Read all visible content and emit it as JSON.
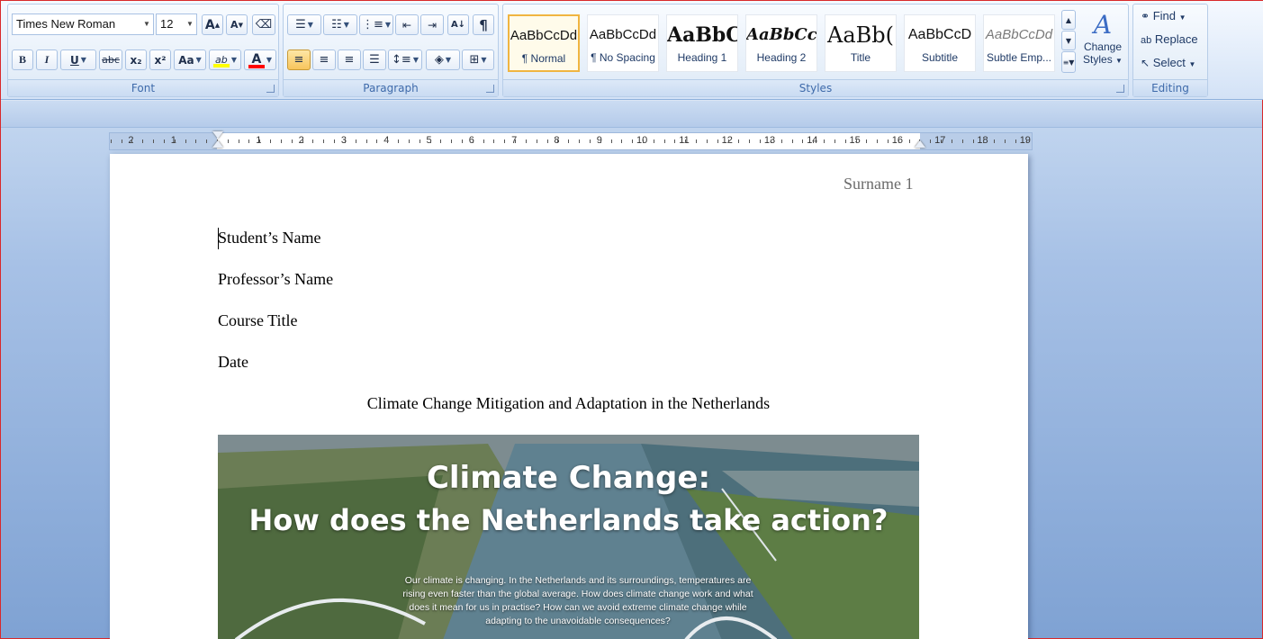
{
  "ribbon": {
    "font": {
      "label": "Font",
      "font_name": "Times New Roman",
      "font_size": "12",
      "bold": "B",
      "italic": "I",
      "underline": "U",
      "strikethrough": "abc",
      "subscript": "x₂",
      "superscript": "x²",
      "change_case": "Aa",
      "highlight": "ab",
      "font_color": "A",
      "grow": "A",
      "shrink": "A"
    },
    "paragraph": {
      "label": "Paragraph",
      "show_marks": "¶"
    },
    "styles": {
      "label": "Styles",
      "items": [
        {
          "preview": "AaBbCcDd",
          "name": "¶ Normal"
        },
        {
          "preview": "AaBbCcDd",
          "name": "¶ No Spacing"
        },
        {
          "preview": "AaBbC",
          "name": "Heading 1"
        },
        {
          "preview": "AaBbCc",
          "name": "Heading 2"
        },
        {
          "preview": "AaBb(",
          "name": "Title"
        },
        {
          "preview": "AaBbCcD",
          "name": "Subtitle"
        },
        {
          "preview": "AaBbCcDd",
          "name": "Subtle Emp..."
        }
      ],
      "change_styles_line1": "Change",
      "change_styles_line2": "Styles"
    },
    "editing": {
      "label": "Editing",
      "find": "Find",
      "replace": "Replace",
      "select": "Select"
    }
  },
  "ruler": {
    "left_numbers": [
      "2",
      "1"
    ],
    "right_numbers": [
      "1",
      "2",
      "3",
      "4",
      "5",
      "6",
      "7",
      "8",
      "9",
      "10",
      "11",
      "12",
      "13",
      "14",
      "15",
      "16",
      "17",
      "18",
      "19"
    ]
  },
  "document": {
    "header": "Surname 1",
    "lines": [
      "Student’s Name",
      "Professor’s Name",
      "Course Title",
      "Date"
    ],
    "title": "Climate Change Mitigation and Adaptation in the Netherlands",
    "image": {
      "title_line1": "Climate Change:",
      "title_line2": "How does the Netherlands take action?",
      "body": "Our climate is changing. In the Netherlands and its surroundings, temperatures are rising even faster than the global average. How does climate change work and what does it mean for us in practise? How can we avoid extreme climate change while adapting to the unavoidable consequences?"
    }
  },
  "colors": {
    "highlight": "#ffff00",
    "font_color": "#ff0000",
    "accent": "#3e6aaa"
  }
}
